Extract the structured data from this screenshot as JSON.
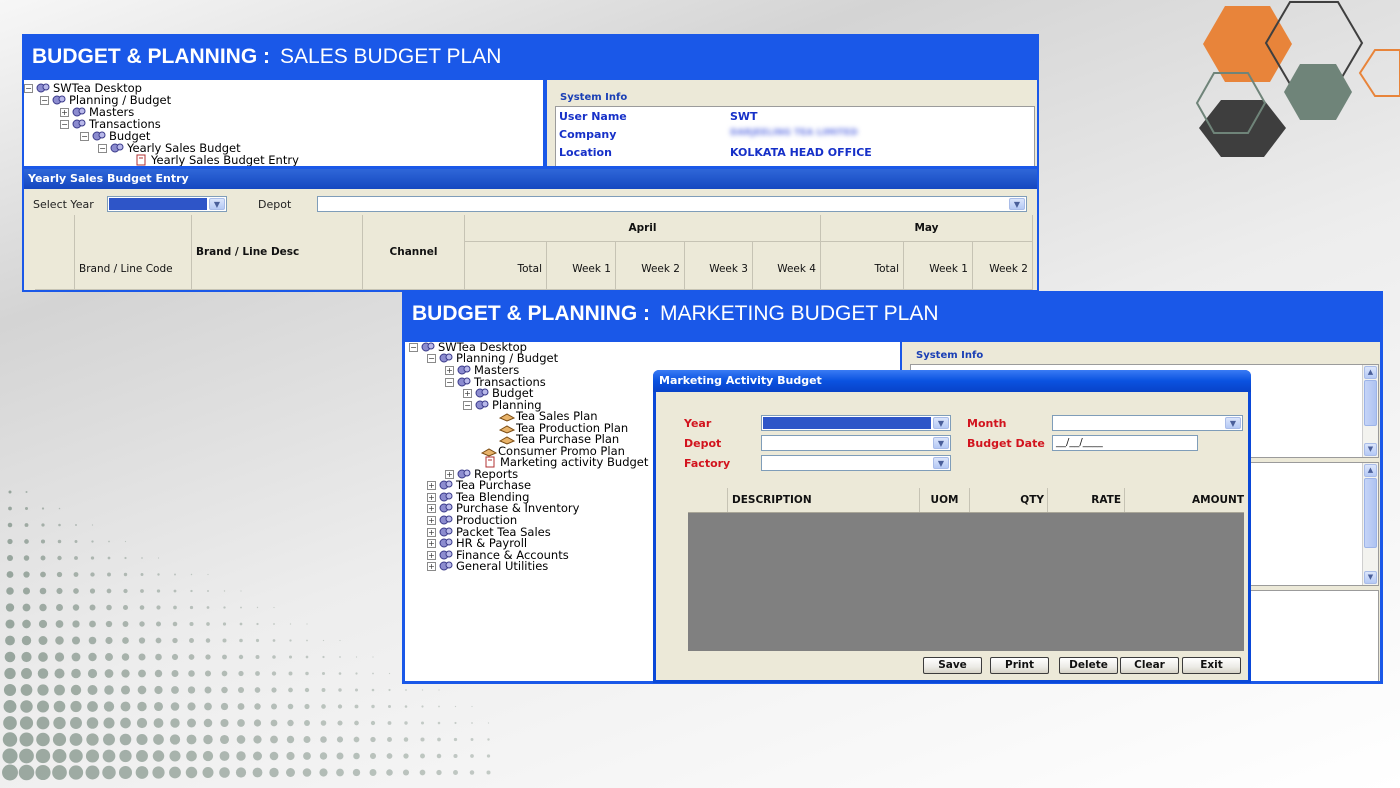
{
  "sales_panel": {
    "title_main": "BUDGET & PLANNING :",
    "title_sub": "SALES BUDGET PLAN",
    "tree": [
      {
        "label": "SWTea Desktop"
      },
      {
        "label": "Planning / Budget"
      },
      {
        "label": "Masters"
      },
      {
        "label": "Transactions"
      },
      {
        "label": "Budget"
      },
      {
        "label": "Yearly Sales Budget"
      },
      {
        "label": "Yearly Sales Budget Entry"
      }
    ],
    "system_info": {
      "legend": "System Info",
      "rows": [
        {
          "label": "User Name",
          "value": "SWT"
        },
        {
          "label": "Company",
          "value": "DARJEELING TEA LIMITED"
        },
        {
          "label": "Location",
          "value": "KOLKATA HEAD OFFICE"
        }
      ]
    },
    "form": {
      "title": "Yearly Sales Budget Entry",
      "select_year_label": "Select Year",
      "depot_label": "Depot",
      "columns": {
        "brand_code": "Brand / Line Code",
        "brand_desc": "Brand / Line Desc",
        "channel": "Channel",
        "month_1": "April",
        "month_2": "May",
        "total": "Total",
        "week_1": "Week 1",
        "week_2": "Week 2",
        "week_3": "Week 3",
        "week_4": "Week 4"
      }
    }
  },
  "marketing_panel": {
    "title_main": "BUDGET & PLANNING :",
    "title_sub": "MARKETING BUDGET PLAN",
    "tree": [
      {
        "label": "SWTea Desktop"
      },
      {
        "label": "Planning / Budget"
      },
      {
        "label": "Masters"
      },
      {
        "label": "Transactions"
      },
      {
        "label": "Budget"
      },
      {
        "label": "Planning"
      },
      {
        "label": "Tea Sales Plan"
      },
      {
        "label": "Tea Production Plan"
      },
      {
        "label": "Tea Purchase Plan"
      },
      {
        "label": "Consumer Promo Plan"
      },
      {
        "label": "Marketing activity Budget"
      },
      {
        "label": "Reports"
      },
      {
        "label": "Tea Purchase"
      },
      {
        "label": "Tea Blending"
      },
      {
        "label": "Purchase & Inventory"
      },
      {
        "label": "Production"
      },
      {
        "label": "Packet Tea Sales"
      },
      {
        "label": "HR & Payroll"
      },
      {
        "label": "Finance & Accounts"
      },
      {
        "label": "General Utilities"
      }
    ],
    "system_info_legend": "System Info",
    "dialog": {
      "title": "Marketing Activity Budget",
      "year_label": "Year",
      "month_label": "Month",
      "depot_label": "Depot",
      "budget_date_label": "Budget Date",
      "budget_date_value": "__/__/____",
      "factory_label": "Factory",
      "columns": [
        "DESCRIPTION",
        "UOM",
        "QTY",
        "RATE",
        "AMOUNT"
      ],
      "buttons": {
        "save": "Save",
        "print": "Print",
        "delete": "Delete",
        "clear": "Clear",
        "exit": "Exit"
      }
    }
  },
  "colors": {
    "brand_blue": "#1a58e8",
    "xp_titlebar": "#0a52e0",
    "form_bg": "#ece9d8",
    "label_red": "#d2141e",
    "info_blue": "#1630c8",
    "hex_orange": "#e8843a",
    "hex_grey_green": "#6f8479",
    "hex_dark": "#3e3e3e"
  }
}
